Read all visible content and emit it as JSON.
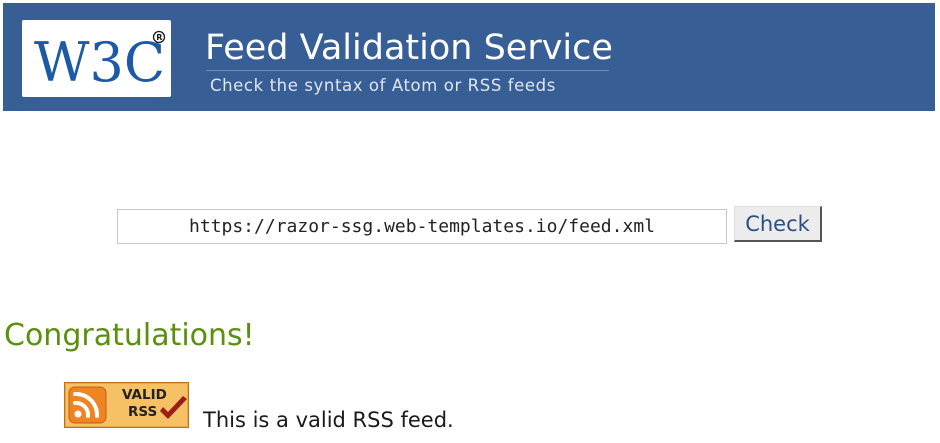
{
  "header": {
    "logo_text": "W3C",
    "title": "Feed Validation Service",
    "subtitle": "Check the syntax of Atom or RSS feeds",
    "background_color": "#385e96"
  },
  "form": {
    "url_value": "https://razor-ssg.web-templates.io/feed.xml",
    "check_label": "Check"
  },
  "result": {
    "heading": "Congratulations!",
    "heading_color": "#5b900f",
    "badge": {
      "line1": "VALID",
      "line2": "RSS",
      "icons": [
        "rss-icon",
        "checkmark-icon"
      ]
    },
    "message": "This is a valid RSS feed."
  }
}
